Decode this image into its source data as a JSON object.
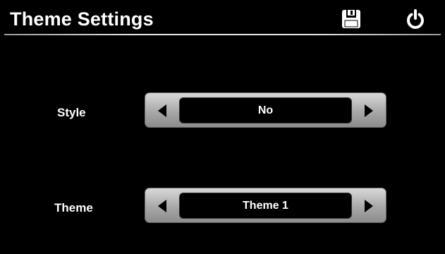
{
  "header": {
    "title": "Theme Settings",
    "save_icon": "floppy-disk-save-icon",
    "power_icon": "power-icon"
  },
  "settings": [
    {
      "label": "Style",
      "value": "No"
    },
    {
      "label": "Theme",
      "value": "Theme 1"
    }
  ],
  "colors": {
    "background": "#000000",
    "text": "#ffffff",
    "control_gray": "#a8a8a8"
  }
}
